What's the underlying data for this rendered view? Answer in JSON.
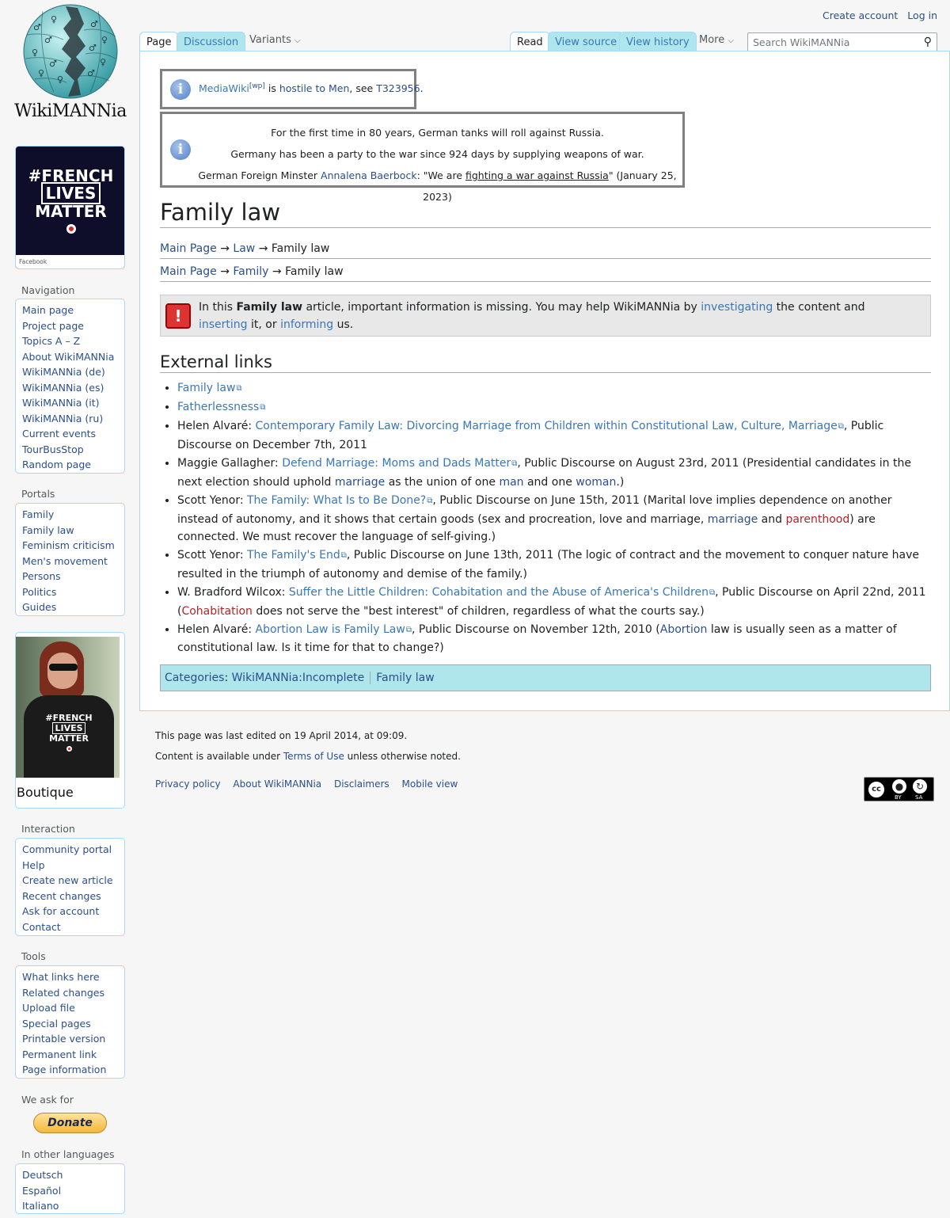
{
  "logo": {
    "wordmark": "WikiMANNia"
  },
  "banner_top": {
    "line1": "#FRENCH",
    "line2": "LIVES",
    "line3": "MATTER",
    "caption": "Facebook"
  },
  "banner_bottom": {
    "shirt1": "#FRENCH",
    "shirt2": "LIVES",
    "shirt3": "MATTER",
    "label": "Boutique"
  },
  "sidebar": {
    "navigation": {
      "title": "Navigation",
      "items": [
        "Main page",
        "Project page",
        "Topics A – Z",
        "About WikiMANNia",
        "WikiMANNia (de)",
        "WikiMANNia (es)",
        "WikiMANNia (it)",
        "WikiMANNia (ru)",
        "Current events",
        "TourBusStop",
        "Random page"
      ]
    },
    "portals": {
      "title": "Portals",
      "items": [
        "Family",
        "Family law",
        "Feminism criticism",
        "Men's movement",
        "Persons",
        "Politics",
        "Guides"
      ]
    },
    "interaction": {
      "title": "Interaction",
      "items": [
        "Community portal",
        "Help",
        "Create new article",
        "Recent changes",
        "Ask for account",
        "Contact"
      ]
    },
    "tools": {
      "title": "Tools",
      "items": [
        "What links here",
        "Related changes",
        "Upload file",
        "Special pages",
        "Printable version",
        "Permanent link",
        "Page information"
      ]
    },
    "weask": {
      "title": "We ask for",
      "donate": "Donate"
    },
    "languages": {
      "title": "In other languages",
      "items": [
        "Deutsch",
        "Español",
        "Italiano"
      ]
    }
  },
  "header": {
    "create_account": "Create account",
    "log_in": "Log in",
    "tabs": {
      "page": "Page",
      "discussion": "Discussion",
      "variants": "Variants",
      "read": "Read",
      "view_source": "View source",
      "view_history": "View history",
      "more": "More"
    },
    "search_placeholder": "Search WikiMANNia"
  },
  "notice1": {
    "link1": "MediaWiki",
    "sup": "[wp]",
    "text1": " is ",
    "link2": "hostile to Men",
    "text2": ", see ",
    "link3": "T323956",
    "text3": "."
  },
  "notice2": {
    "line1": "For the first time in 80 years, German tanks will roll against Russia.",
    "line2": "Germany has been a party to the war since 924 days by supplying weapons of war.",
    "line3_a": "German Foreign Minster ",
    "line3_link": "Annalena Baerbock",
    "line3_b": ": \"We are ",
    "line3_u": "fighting a war against Russia",
    "line3_c": "\" (January 25, 2023)"
  },
  "page": {
    "title": "Family law",
    "crumb1": {
      "a": "Main Page",
      "arrow": " → ",
      "b": "Law",
      "c": "Family law"
    },
    "crumb2": {
      "a": "Main Page",
      "arrow": " → ",
      "b": "Family",
      "c": "Family law"
    },
    "ambox": {
      "t1": "In this ",
      "bold": "Family law",
      "t2": " article, important information is missing. You may help WikiMANNia by ",
      "l1": "investigating",
      "t3": " the content and ",
      "l2": "inserting",
      "t4": " it, or ",
      "l3": "informing",
      "t5": " us.",
      "icon": "!"
    },
    "section_title": "External links",
    "links": [
      {
        "link": "Family law"
      },
      {
        "link": "Fatherlessness"
      },
      {
        "pre": "Helen Alvaré: ",
        "link": "Contemporary Family Law: Divorcing Marriage from Children within Constitutional Law, Culture, Marriage",
        "post": ", Public Discourse on December 7th, 2011"
      },
      {
        "pre": "Maggie Gallagher: ",
        "link": "Defend Marriage: Moms and Dads Matter",
        "post": ", Public Discourse on August 23rd, 2011 (Presidential candidates in the next election should uphold ",
        "w1": "marriage",
        "m1": " as the union of one ",
        "w2": "man",
        "m2": " and one ",
        "w3": "woman",
        "end": ".)"
      },
      {
        "pre": "Scott Yenor: ",
        "link": "The Family: What Is to Be Done?",
        "post": ", Public Discourse on June 15th, 2011 (Marital love implies dependence on another instead of autonomy, and it shows that certain goods (sex and procreation, love and marriage, ",
        "w1": "marriage",
        "m1": " and ",
        "w2": "parenthood",
        "end": ") are connected. We must recover the language of self-giving.)"
      },
      {
        "pre": "Scott Yenor: ",
        "link": "The Family's End",
        "post": ", Public Discourse on June 13th, 2011 (The logic of contract and the movement to conquer nature have resulted in the triumph of autonomy and demise of the family.)"
      },
      {
        "pre": "W. Bradford Wilcox: ",
        "link": "Suffer the Little Children: Cohabitation and the Abuse of America's Children",
        "post": ", Public Discourse on April 22nd, 2011 (",
        "w1": "Cohabitation",
        "end": " does not serve the \"best interest\" of children, regardless of what the courts say.)"
      },
      {
        "pre": "Helen Alvaré: ",
        "link": "Abortion Law is Family Law",
        "post": ", Public Discourse on November 12th, 2010 (",
        "w1": "Abortion",
        "end": " law is usually seen as a matter of constitutional law. Is it time for that to change?)"
      }
    ],
    "categories": {
      "label": "Categories",
      "colon": ": ",
      "items": [
        "WikiMANNia:Incomplete",
        "Family law"
      ]
    }
  },
  "footer": {
    "edited": "This page was last edited on 19 April 2014, at 09:09.",
    "content_a": "Content is available under ",
    "content_link": "Terms of Use",
    "content_b": " unless otherwise noted.",
    "links": [
      "Privacy policy",
      "About WikiMANNia",
      "Disclaimers",
      "Mobile view"
    ],
    "cc_by": "BY",
    "cc_sa": "SA"
  }
}
